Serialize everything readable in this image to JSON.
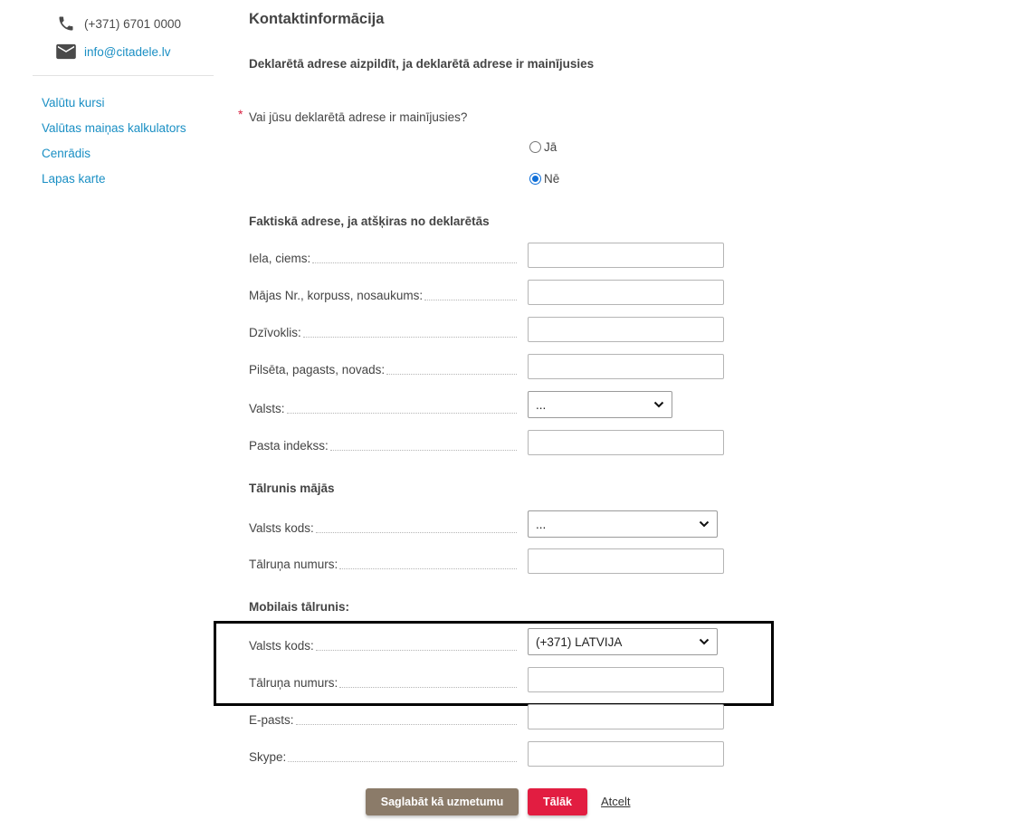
{
  "sidebar": {
    "phone": "(+371) 6701 0000",
    "email": "info@citadele.lv",
    "links": [
      "Valūtu kursi",
      "Valūtas maiņas kalkulators",
      "Cenrādis",
      "Lapas karte"
    ]
  },
  "form": {
    "title": "Kontaktinformācija",
    "declared_note": "Deklarētā adrese aizpildīt, ja deklarētā adrese ir mainījusies",
    "required_marker": "*",
    "question": "Vai jūsu deklarētā adrese ir mainījusies?",
    "options": [
      {
        "label": "Jā",
        "checked": false
      },
      {
        "label": "Nē",
        "checked": true
      }
    ],
    "actual_address": {
      "title": "Faktiskā adrese, ja atšķiras no deklarētās",
      "street_label": "Iela, ciems:",
      "house_label": "Mājas Nr., korpuss, nosaukums:",
      "apartment_label": "Dzīvoklis:",
      "city_label": "Pilsēta, pagasts, novads:",
      "country_label": "Valsts:",
      "country_value": "...",
      "postal_label": "Pasta indekss:"
    },
    "home_phone": {
      "title": "Tālrunis mājās",
      "code_label": "Valsts kods:",
      "code_value": "...",
      "number_label": "Tālruņa numurs:"
    },
    "mobile_phone": {
      "title": "Mobilais tālrunis:",
      "code_label": "Valsts kods:",
      "code_value": "(+371) LATVIJA",
      "number_label": "Tālruņa numurs:"
    },
    "email_label": "E-pasts:",
    "skype_label": "Skype:"
  },
  "actions": {
    "save_draft": "Saglabāt kā uzmetumu",
    "next": "Tālāk",
    "cancel": "Atcelt"
  },
  "colors": {
    "link": "#1a8fc4",
    "primary_button": "#e21d41",
    "secondary_button": "#8b7b69",
    "radio_selected": "#0f6fd8",
    "required": "#d81f3f"
  },
  "icons": {
    "phone": "phone-icon",
    "email": "mail-icon",
    "select": "chevron-down-icon"
  }
}
